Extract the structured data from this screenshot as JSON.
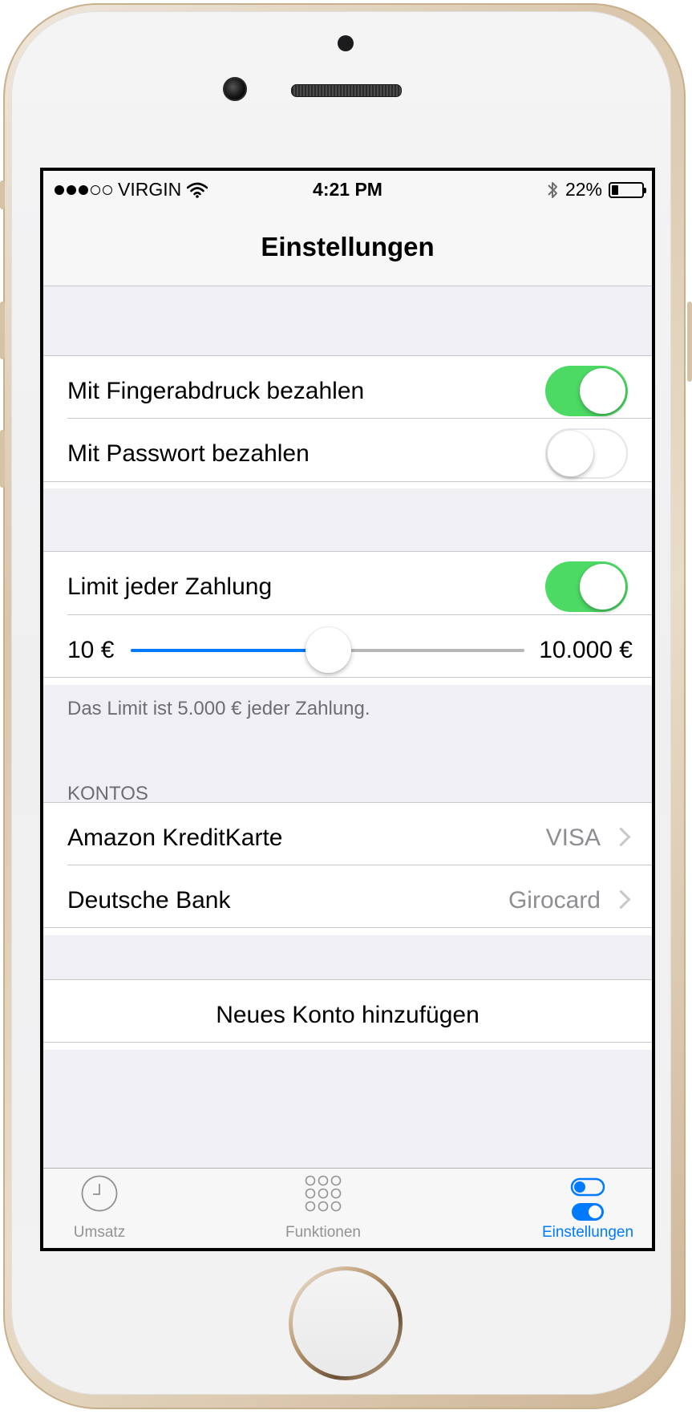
{
  "status_bar": {
    "carrier": "VIRGIN",
    "signal_bars_filled": 3,
    "signal_bars_total": 5,
    "time": "4:21 PM",
    "battery_percent": "22%",
    "battery_level": 0.22
  },
  "nav": {
    "title": "Einstellungen"
  },
  "payment_section": {
    "fingerprint": {
      "label": "Mit Fingerabdruck bezahlen",
      "on": true
    },
    "password": {
      "label": "Mit Passwort bezahlen",
      "on": false
    }
  },
  "limit_section": {
    "limit_toggle": {
      "label": "Limit jeder Zahlung",
      "on": true
    },
    "slider": {
      "min_label": "10 €",
      "max_label": "10.000 €",
      "value_fraction": 0.5
    },
    "footer": "Das Limit ist 5.000 € jeder Zahlung."
  },
  "accounts_section": {
    "header": "KONTOS",
    "items": [
      {
        "name": "Amazon KreditKarte",
        "type": "VISA"
      },
      {
        "name": "Deutsche Bank",
        "type": "Girocard"
      }
    ]
  },
  "add_account": {
    "label": "Neues Konto hinzufügen"
  },
  "tab_bar": {
    "tabs": [
      {
        "label": "Umsatz",
        "icon": "clock-icon",
        "active": false
      },
      {
        "label": "Funktionen",
        "icon": "grid-icon",
        "active": false
      },
      {
        "label": "Einstellungen",
        "icon": "toggles-icon",
        "active": true
      }
    ]
  },
  "colors": {
    "accent": "#007aff",
    "toggle_on": "#4cd964",
    "grouped_background": "#efeff4"
  }
}
